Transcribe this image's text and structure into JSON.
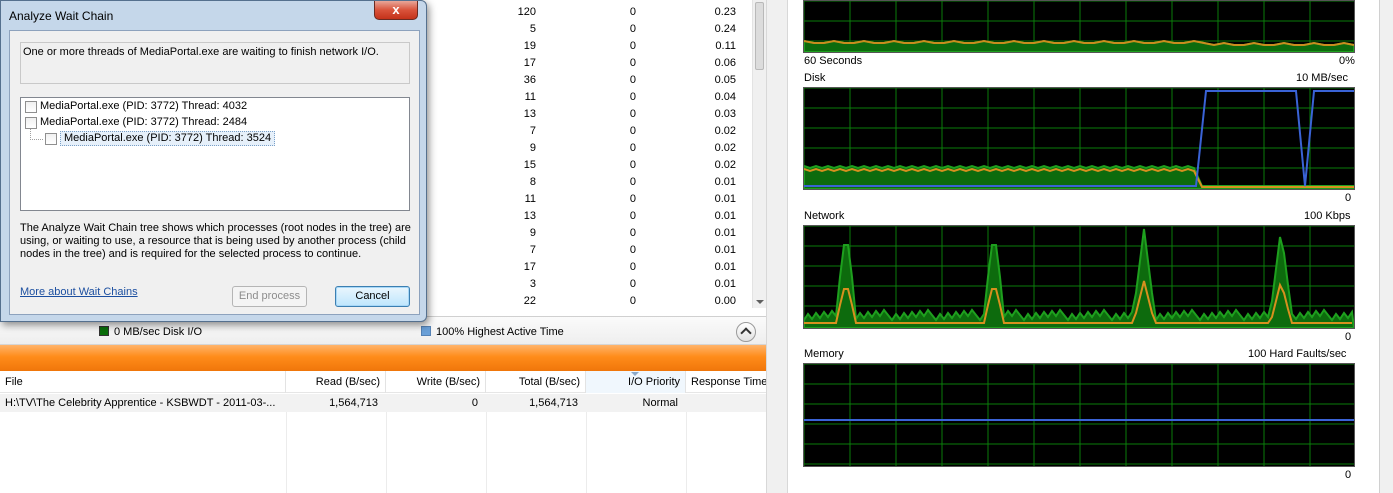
{
  "dialog": {
    "title": "Analyze Wait Chain",
    "close_label": "x",
    "message": "One or more threads of MediaPortal.exe are waiting to finish network I/O.",
    "tree": [
      {
        "label": "MediaPortal.exe (PID: 3772) Thread: 4032",
        "checked": false,
        "level": 0
      },
      {
        "label": "MediaPortal.exe (PID: 3772) Thread: 2484",
        "checked": false,
        "level": 0
      },
      {
        "label": "MediaPortal.exe (PID: 3772) Thread: 3524",
        "checked": false,
        "level": 1,
        "selected": true
      }
    ],
    "info": "The Analyze Wait Chain tree shows which processes (root nodes in the tree) are using, or waiting to use, a resource that is being used by another process (child nodes in the tree) and is required for the selected process to continue.",
    "link": "More about Wait Chains",
    "end_button": "End process",
    "cancel_button": "Cancel"
  },
  "process_rows": [
    [
      "120",
      "0",
      "0.23"
    ],
    [
      "5",
      "0",
      "0.24"
    ],
    [
      "19",
      "0",
      "0.11"
    ],
    [
      "17",
      "0",
      "0.06"
    ],
    [
      "36",
      "0",
      "0.05"
    ],
    [
      "11",
      "0",
      "0.04"
    ],
    [
      "13",
      "0",
      "0.03"
    ],
    [
      "7",
      "0",
      "0.02"
    ],
    [
      "9",
      "0",
      "0.02"
    ],
    [
      "15",
      "0",
      "0.02"
    ],
    [
      "8",
      "0",
      "0.01"
    ],
    [
      "11",
      "0",
      "0.01"
    ],
    [
      "13",
      "0",
      "0.01"
    ],
    [
      "9",
      "0",
      "0.01"
    ],
    [
      "7",
      "0",
      "0.01"
    ],
    [
      "17",
      "0",
      "0.01"
    ],
    [
      "3",
      "0",
      "0.01"
    ],
    [
      "22",
      "0",
      "0.00"
    ]
  ],
  "disk_section": {
    "legend1": "0 MB/sec Disk I/O",
    "legend1_color": "#0a6e0a",
    "legend2": "100% Highest Active Time",
    "legend2_color": "#6aa0d8"
  },
  "file_table": {
    "columns": [
      "File",
      "Read (B/sec)",
      "Write (B/sec)",
      "Total (B/sec)",
      "I/O Priority",
      "Response Time"
    ],
    "rows": [
      [
        "H:\\TV\\The Celebrity Apprentice - KSBWDT - 2011-03-...",
        "1,564,713",
        "0",
        "1,564,713",
        "Normal",
        ""
      ]
    ]
  },
  "graphs": {
    "cpu": {
      "left_label": "60 Seconds",
      "right_label": "0%"
    },
    "disk": {
      "title": "Disk",
      "scale": "10 MB/sec",
      "min": "0"
    },
    "network": {
      "title": "Network",
      "scale": "100 Kbps",
      "min": "0"
    },
    "memory": {
      "title": "Memory",
      "scale": "100 Hard Faults/sec",
      "min": "0"
    }
  }
}
